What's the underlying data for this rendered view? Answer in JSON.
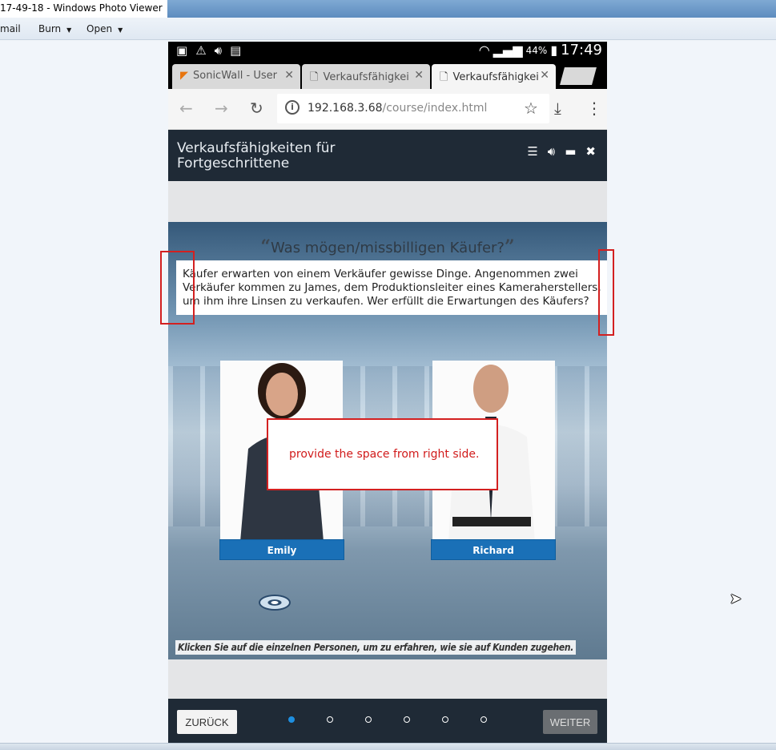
{
  "viewer": {
    "title": "17-49-18 - Windows Photo Viewer",
    "menu": {
      "mail": "mail",
      "burn": "Burn",
      "open": "Open"
    }
  },
  "phone": {
    "status": {
      "battery": "44%",
      "time": "17:49"
    },
    "tabs": [
      {
        "label": "SonicWall - User",
        "icon": "sonicwall-favicon"
      },
      {
        "label": "Verkaufsfähigkei",
        "icon": "document-icon"
      },
      {
        "label": "Verkaufsfähigkei",
        "icon": "document-icon"
      }
    ],
    "address": {
      "host": "192.168.3.68",
      "path": "/course/index.html"
    },
    "course": {
      "title": "Verkaufsfähigkeiten für Fortgeschrittene",
      "heading": "Was mögen/missbilligen Käufer?",
      "intro": "Käufer erwarten von einem Verkäufer gewisse Dinge. Angenommen zwei Verkäufer kommen zu James, dem Produktionsleiter eines Kameraherstellers, um ihm ihre Linsen zu verkaufen. Wer erfüllt die Erwartungen des Käufers?",
      "people": [
        "Emily",
        "Richard"
      ],
      "hint": "Klicken Sie auf die einzelnen Personen, um zu erfahren, wie sie auf Kunden zugehen.",
      "nav": {
        "back": "ZURÜCK",
        "next": "WEITER",
        "pages": 6,
        "current": 1
      }
    }
  },
  "annotation": {
    "text": "provide the space from right side."
  },
  "colors": {
    "header": "#1f2a36",
    "accent": "#1a70b7",
    "annotation": "#d32020"
  }
}
